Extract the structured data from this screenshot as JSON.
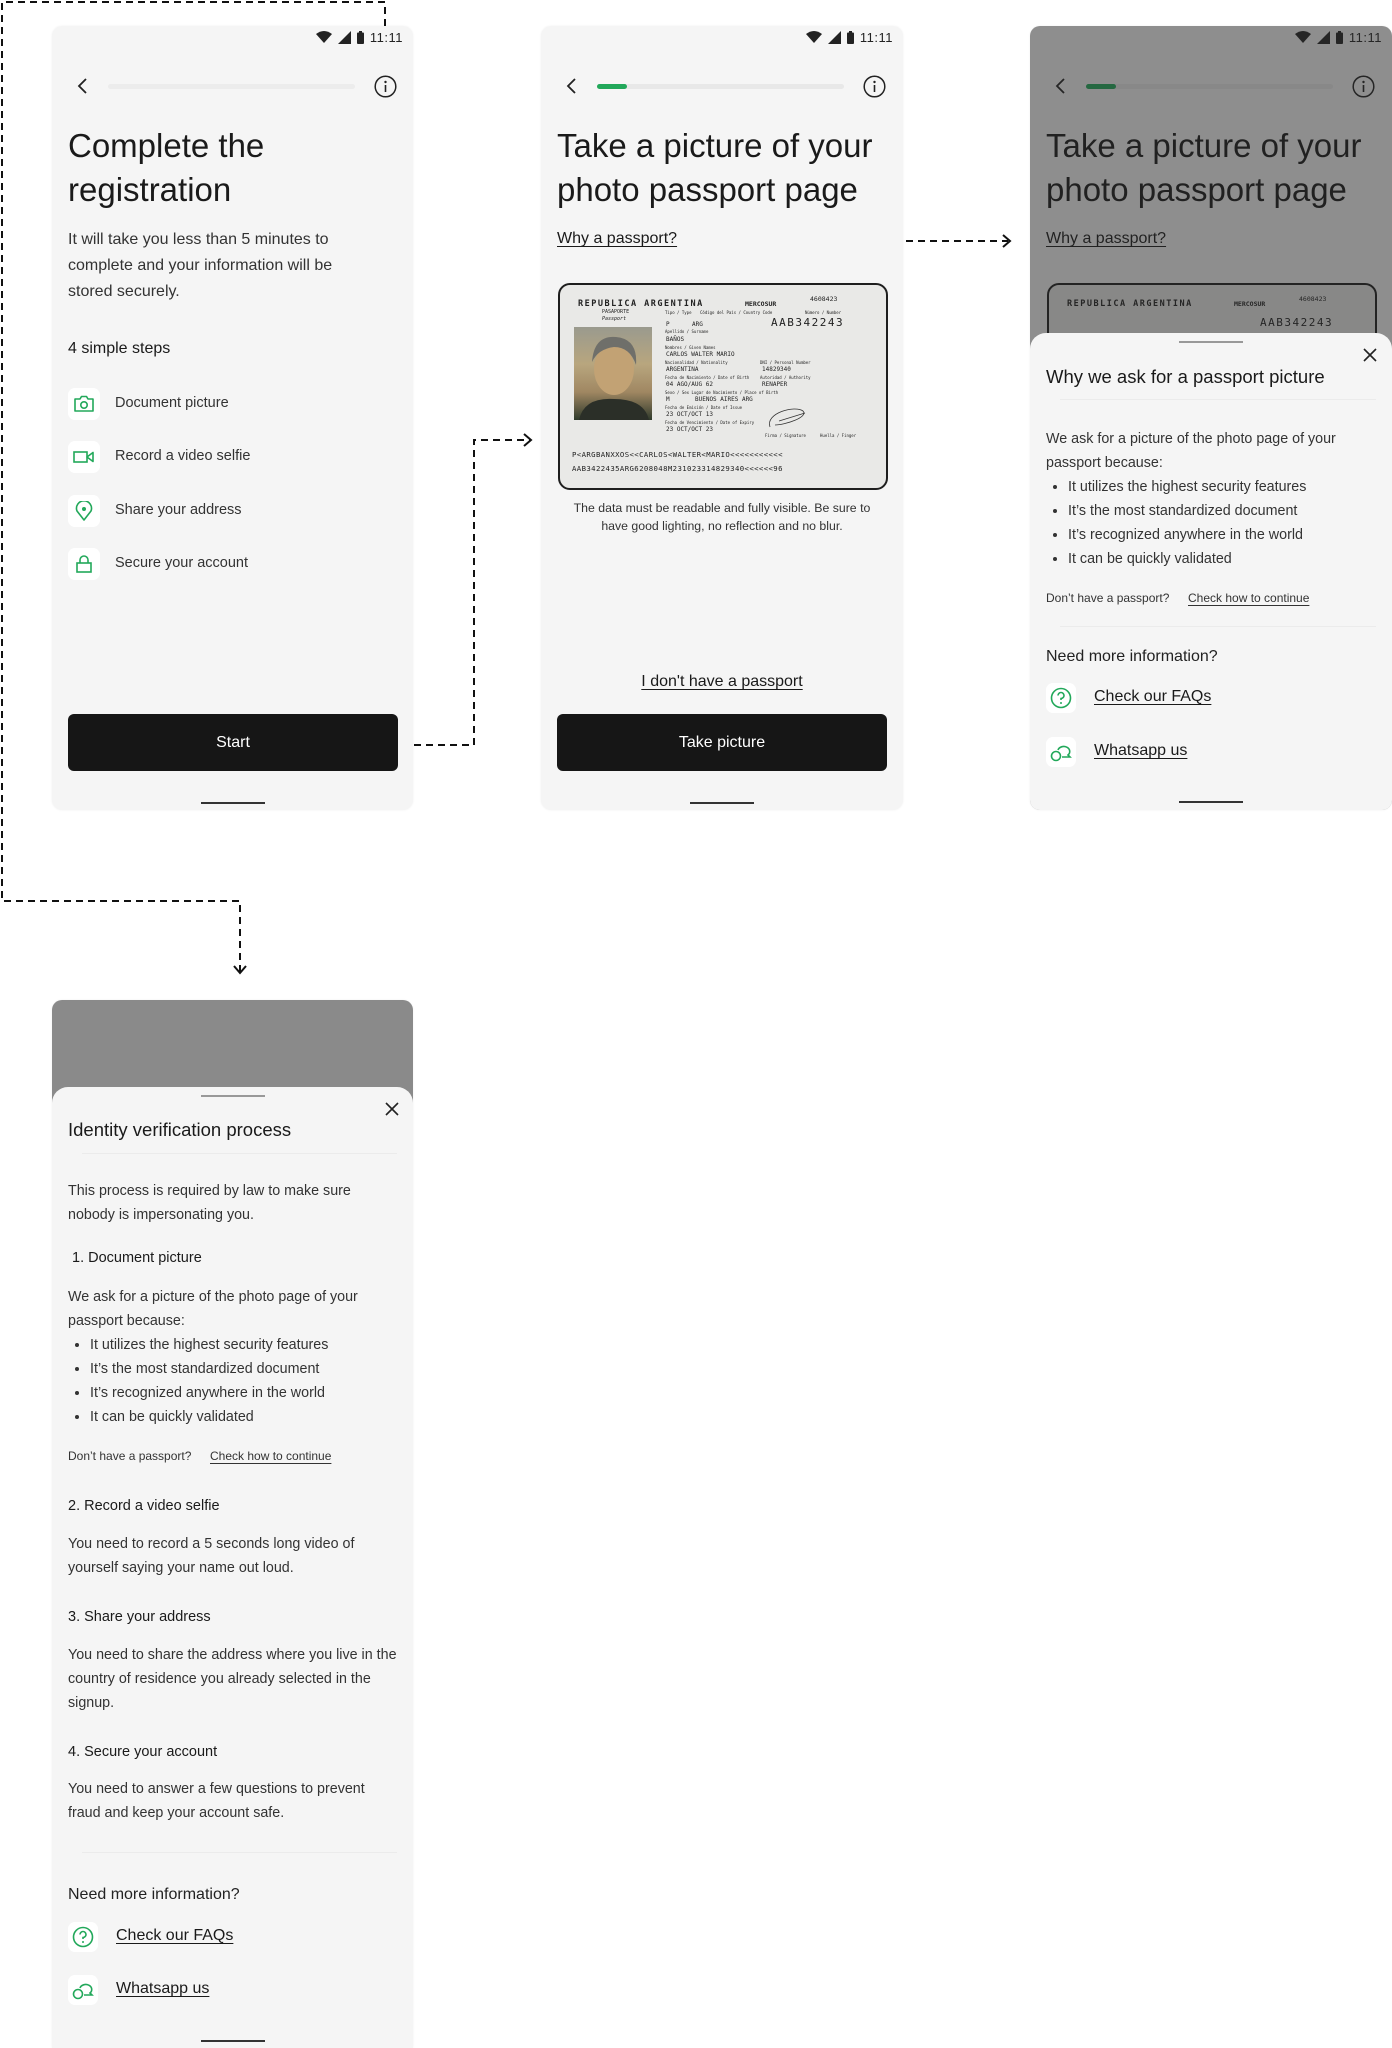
{
  "colors": {
    "accent": "#22a85a",
    "button": "#161616",
    "screen_bg": "#f5f5f5"
  },
  "status_bar": {
    "time": "11:11",
    "icons": [
      "wifi-icon",
      "signal-icon",
      "battery-icon"
    ]
  },
  "screen1": {
    "progress": 0,
    "title": "Complete the registration",
    "subtitle": "It will take you less than 5 minutes to complete and your information will be stored securely.",
    "steps_heading": "4 simple steps",
    "steps": [
      {
        "icon": "camera-icon",
        "label": "Document picture"
      },
      {
        "icon": "video-icon",
        "label": "Record a video selfie"
      },
      {
        "icon": "location-pin-icon",
        "label": "Share your address"
      },
      {
        "icon": "lock-icon",
        "label": "Secure your account"
      }
    ],
    "start_label": "Start"
  },
  "screen2": {
    "progress": 0.12,
    "title": "Take a picture of your photo passport page",
    "why_link": "Why a passport?",
    "caption": "The data must be readable and fully visible. Be sure to have good lighting, no reflection and no blur.",
    "no_passport_link": "I don't have a passport",
    "take_picture_label": "Take picture"
  },
  "passport": {
    "country": "REPUBLICA ARGENTINA",
    "union": "MERCOSUR",
    "serial": "4608423",
    "doc_type": "PASAPORTE",
    "doc_type_en": "Passport",
    "type_label": "Tipo / Type",
    "type": "P",
    "country_code_label": "Código del País / Country Code",
    "country_code": "ARG",
    "number_label": "Número / Number",
    "number": "AAB342243",
    "surname_label": "Apellido / Surname",
    "surname": "BAÑOS",
    "given_label": "Nombres / Given Names",
    "given": "CARLOS WALTER MARIO",
    "nationality_label": "Nacionalidad / Nationality",
    "nationality": "ARGENTINA",
    "dni_label": "DNI / Personal Number",
    "dni": "14829340",
    "dob_label": "Fecha de Nacimiento / Date of Birth",
    "dob": "04 AGO/AUG 62",
    "authority_label": "Autoridad / Authority",
    "authority": "RENAPER",
    "sex_label": "Sexo / Sex   Lugar de Nacimiento / Place of Birth",
    "sex": "M",
    "pob": "BUENOS AIRES ARG",
    "issue_label": "Fecha de Emisión / Date of Issue",
    "issue": "23 OCT/OCT 13",
    "expiry_label": "Fecha de Vencimiento / Date of Expiry",
    "expiry": "23 OCT/OCT 23",
    "signature_label": "Firma / Signature",
    "finger_label": "Huella / Finger",
    "mrz1": "P<ARGBANXXOS<<CARLOS<WALTER<MARIO<<<<<<<<<<<",
    "mrz2": "AAB3422435ARG6208048M231023314829340<<<<<<96"
  },
  "screen3": {
    "sheet_title": "Why we ask for a passport picture",
    "intro": "We ask for a picture of the photo page of your passport because:",
    "bullets": [
      "It utilizes the highest security features",
      "It’s the most standardized document",
      "It’s recognized anywhere in the world",
      "It can be quickly validated"
    ],
    "no_passport_text": "Don’t have a passport?",
    "check_link": "Check how to continue",
    "more_info": "Need more information?",
    "faq_link": "Check our FAQs",
    "whatsapp_link": "Whatsapp us"
  },
  "screen4": {
    "sheet_title": "Identity verification process",
    "intro": "This process is required by law to make sure nobody is impersonating you.",
    "step1_heading": "1. Document picture",
    "step1_intro": "We ask for a picture of the photo page of your passport because:",
    "bullets": [
      "It utilizes the highest security features",
      "It’s the most standardized document",
      "It’s recognized anywhere in the world",
      "It can be quickly validated"
    ],
    "no_passport_text": "Don’t have a passport?",
    "check_link": "Check how to continue",
    "step2_heading": "2. Record a video selfie",
    "step2_text": "You need to record a 5 seconds long video of yourself saying your name out loud.",
    "step3_heading": "3. Share your address",
    "step3_text": "You need to share the address where you live in the country of residence you already selected in the signup.",
    "step4_heading": "4. Secure your account",
    "step4_text": "You need to answer a few questions to prevent fraud and keep your account safe.",
    "more_info": "Need more information?",
    "faq_link": "Check our FAQs",
    "whatsapp_link": "Whatsapp us"
  }
}
